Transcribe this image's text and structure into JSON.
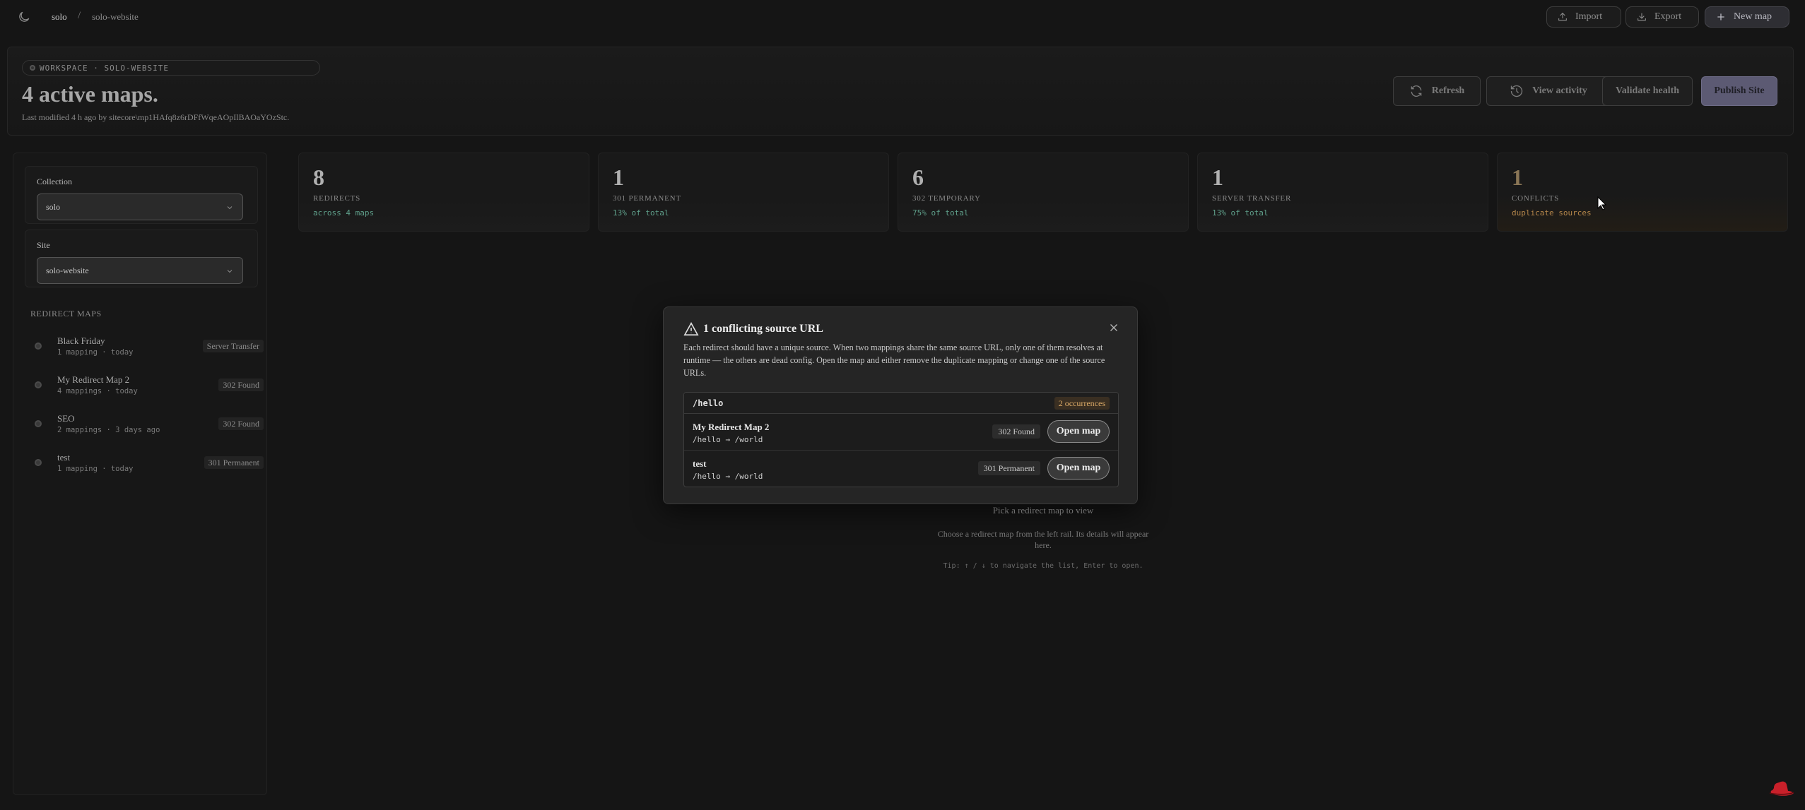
{
  "topbar": {
    "crumb_workspace": "solo",
    "crumb_separator": "/",
    "crumb_site": "solo-website",
    "import_label": "Import",
    "export_label": "Export",
    "new_map_label": "New map"
  },
  "header": {
    "workspace_pill": "WORKSPACE · SOLO-WEBSITE",
    "title": "4 active maps.",
    "last_modified": "Last modified 4 h ago by sitecore\\mp1HAfq8z6rDFfWqeAOpIlBAOaYOzStc.",
    "refresh_label": "Refresh",
    "view_activity_label": "View activity",
    "validate_label": "Validate health",
    "publish_label": "Publish Site"
  },
  "rail": {
    "collection_label": "Collection",
    "collection_value": "solo",
    "site_label": "Site",
    "site_value": "solo-website",
    "maps_title": "REDIRECT MAPS",
    "maps": [
      {
        "name": "Black Friday",
        "meta": "1 mapping · today",
        "badge": "Server Transfer"
      },
      {
        "name": "My Redirect Map 2",
        "meta": "4 mappings · today",
        "badge": "302 Found"
      },
      {
        "name": "SEO",
        "meta": "2 mappings · 3 days ago",
        "badge": "302 Found"
      },
      {
        "name": "test",
        "meta": "1 mapping · today",
        "badge": "301 Permanent"
      }
    ]
  },
  "stats": [
    {
      "value": "8",
      "label": "REDIRECTS",
      "sub": "across 4 maps"
    },
    {
      "value": "1",
      "label": "301 PERMANENT",
      "sub": "13% of total"
    },
    {
      "value": "6",
      "label": "302 TEMPORARY",
      "sub": "75% of total"
    },
    {
      "value": "1",
      "label": "SERVER TRANSFER",
      "sub": "13% of total"
    },
    {
      "value": "1",
      "label": "CONFLICTS",
      "sub": "duplicate sources"
    }
  ],
  "empty": {
    "title": "Pick a redirect map to view",
    "desc": "Choose a redirect map from the left rail. Its details will appear here.",
    "tip": "Tip: ↑ / ↓ to navigate the list, Enter to open."
  },
  "modal": {
    "title": "1 conflicting source URL",
    "desc": "Each redirect should have a unique source. When two mappings share the same source URL, only one of them resolves at runtime — the others are dead config. Open the map and either remove the duplicate mapping or change one of the source URLs.",
    "source": "/hello",
    "occurrences": "2 occurrences",
    "rows": [
      {
        "map": "My Redirect Map 2",
        "path": "/hello → /world",
        "status": "302 Found",
        "action": "Open map"
      },
      {
        "map": "test",
        "path": "/hello → /world",
        "status": "301 Permanent",
        "action": "Open map"
      }
    ]
  },
  "colors": {
    "background": "#151515",
    "accent": "#5c5a73",
    "stat_sub": "#5fa08b",
    "conflict": "#b5874a"
  }
}
